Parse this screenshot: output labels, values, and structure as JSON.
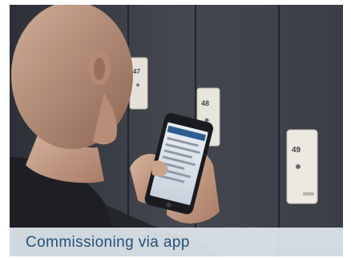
{
  "caption": {
    "text": "Commissioning via app"
  },
  "lockers": {
    "left_number": "47",
    "middle_number": "48",
    "right_number": "49"
  },
  "colors": {
    "caption_text": "#1f4f7a",
    "caption_bg": "#e1e8ee",
    "locker_wall": "#3a3d44"
  }
}
